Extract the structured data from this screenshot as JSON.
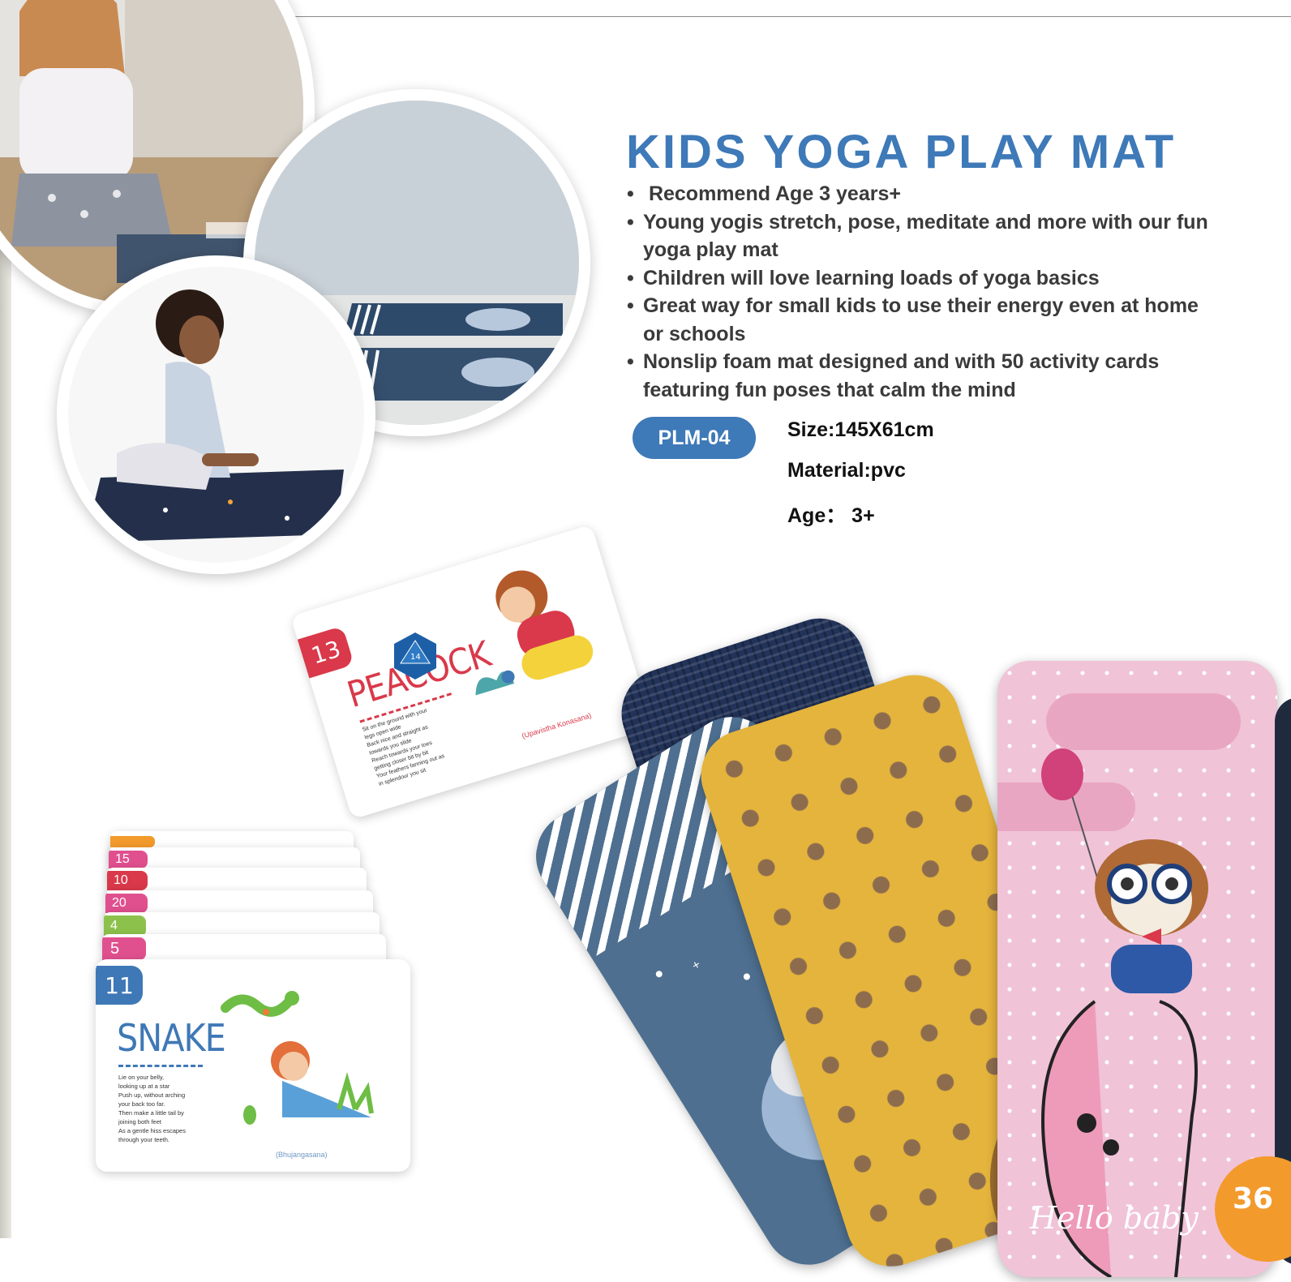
{
  "product": {
    "title": "KIDS YOGA PLAY MAT",
    "bullets": [
      " Recommend Age 3 years+",
      "Young yogis stretch, pose, meditate and more with our fun yoga play mat",
      "Children will love learning loads of yoga basics",
      "Great way for small kids to use their energy even at home or schools",
      "Nonslip foam mat designed and with 50 activity cards featuring fun poses that calm the mind"
    ],
    "code": "PLM-04",
    "specs": {
      "size": "Size:145X61cm",
      "material": "Material:pvc",
      "age": "Age： 3+"
    }
  },
  "cards": {
    "peacock": {
      "number": "13",
      "name": "PEACOCK",
      "text": "Sit on the ground with your\nlegs open wide\nBack nice and straight as\ntowards you slide\nReach towards your toes\ngetting closer bit by bit\nYour feathers fanning out as\nin splendour you sit",
      "sanskrit": "(Upavistha Konasana)"
    },
    "snake": {
      "number": "11",
      "name": "SNAKE",
      "text": "Lie on your belly,\nlooking up at a star\nPush up, without arching\nyour back too far.\nThen make a little tail by\njoining both feet\nAs a gentle hiss escapes\nthrough your teeth.",
      "sanskrit": "(Bhujangasana)"
    },
    "stack_tabs": [
      "5",
      "4",
      "20",
      "10",
      "15"
    ]
  },
  "mat_text": "Hello baby",
  "page_number": "36",
  "colors": {
    "accent_blue": "#3e79b8",
    "tab_red": "#d9394a",
    "tab_orange": "#f39a2c",
    "mat_yellow": "#e5b43c",
    "mat_pink": "#f0c3d7",
    "mat_navy": "#22335a"
  }
}
